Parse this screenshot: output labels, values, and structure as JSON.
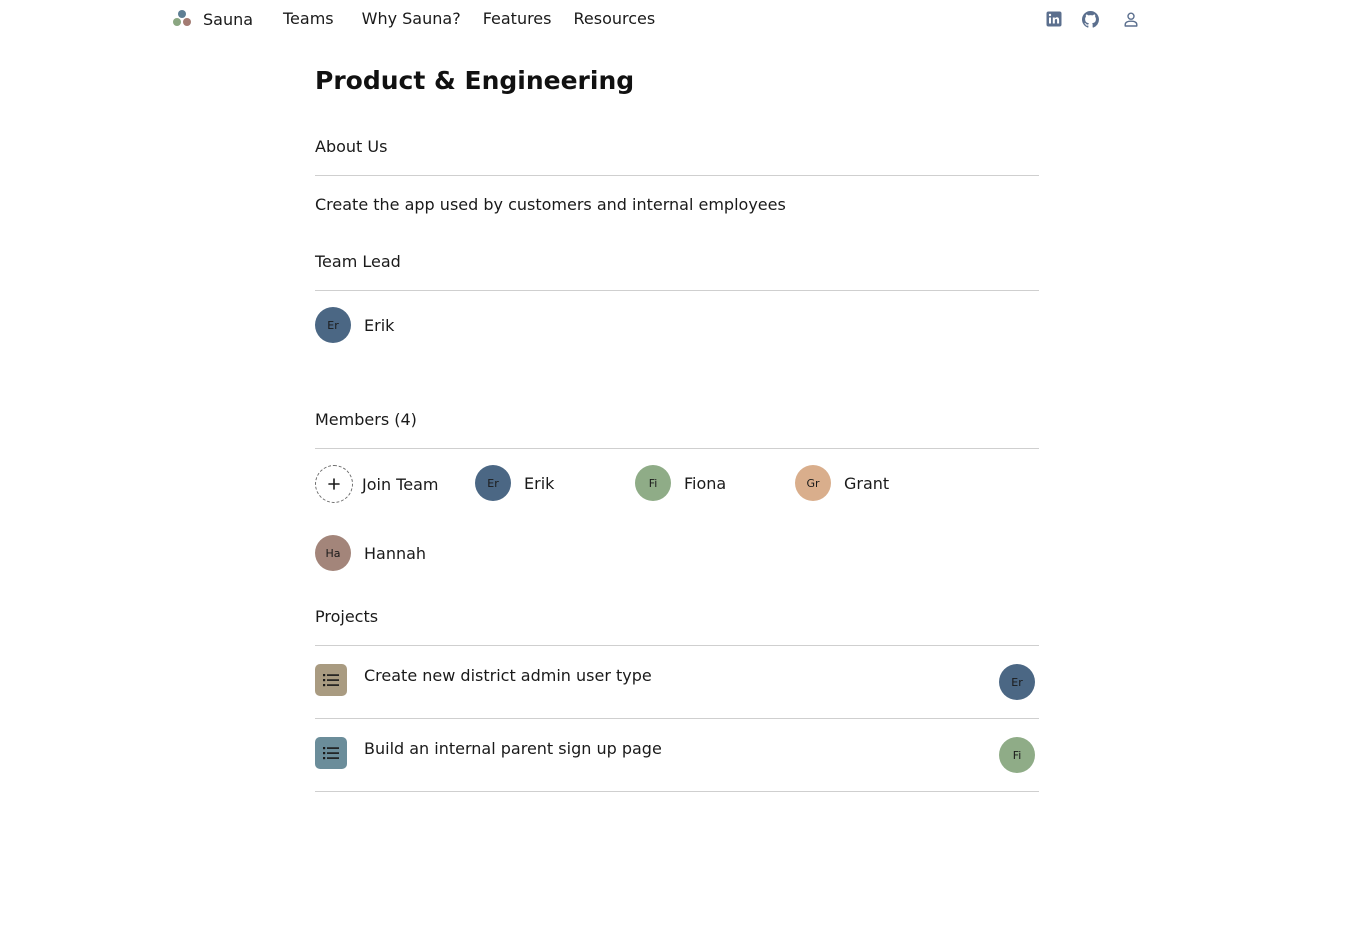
{
  "nav": {
    "brand": "Sauna",
    "links": [
      "Teams",
      "Why Sauna?",
      "Features",
      "Resources"
    ],
    "icons": [
      "linkedin-icon",
      "github-icon",
      "user-icon"
    ],
    "icon_color": "#5b6f8e"
  },
  "team": {
    "title": "Product & Engineering",
    "about_heading": "About Us",
    "about_text": "Create the app used by customers and internal employees",
    "lead_heading": "Team Lead",
    "lead": {
      "initials": "Er",
      "name": "Erik",
      "color": "#4b6784"
    },
    "members_heading": "Members (4)",
    "join_label": "Join Team",
    "members": [
      {
        "initials": "Er",
        "name": "Erik",
        "color": "#4b6784"
      },
      {
        "initials": "Fi",
        "name": "Fiona",
        "color": "#8fac87"
      },
      {
        "initials": "Gr",
        "name": "Grant",
        "color": "#d9ae8c"
      },
      {
        "initials": "Ha",
        "name": "Hannah",
        "color": "#a3857a"
      }
    ],
    "projects_heading": "Projects",
    "projects": [
      {
        "title": "Create new district admin user type",
        "icon": "list-icon",
        "icon_color": "#a99b81",
        "owner": "Er",
        "owner_color": "#4b6784"
      },
      {
        "title": "Build an internal parent sign up page",
        "icon": "list-icon",
        "icon_color": "#6b8d9a",
        "owner": "Fi",
        "owner_color": "#8fac87"
      }
    ]
  }
}
